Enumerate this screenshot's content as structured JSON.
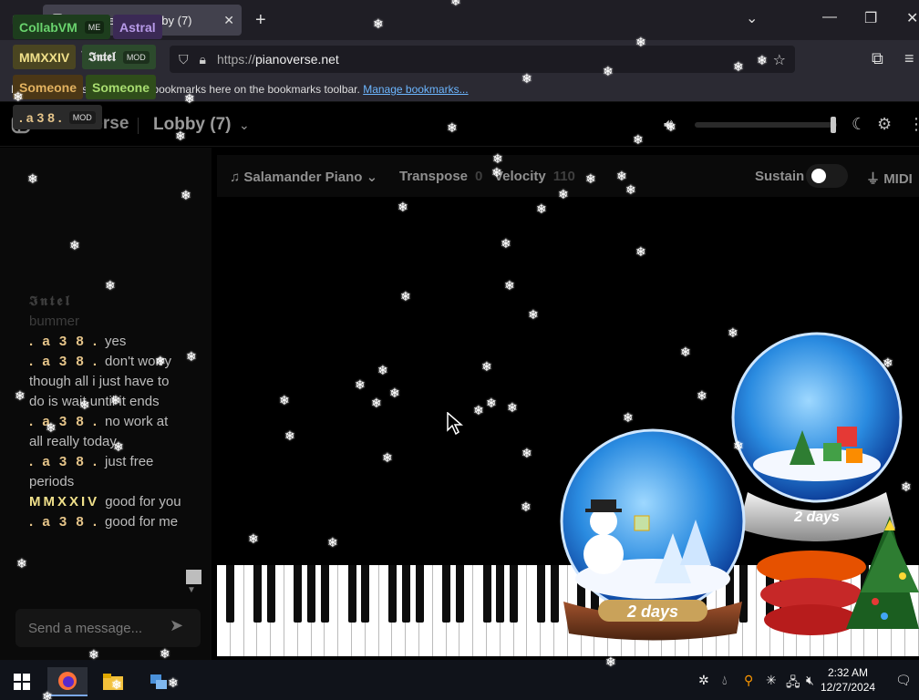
{
  "browser": {
    "tab_title": "Pianoverse - Lobby (7)",
    "url_prefix": "https://",
    "url_host": "pianoverse.net",
    "bookmarks_text": "For quick access, place your bookmarks here on the bookmarks toolbar.",
    "bookmarks_link": "Manage bookmarks..."
  },
  "header": {
    "logo": "Pianoverse",
    "room": "Lobby (7)"
  },
  "users": [
    {
      "name": "CollabVM",
      "badge": "ME",
      "bg": "#1d3d1d",
      "fg": "#69d36d"
    },
    {
      "name": "Astral",
      "badge": "",
      "bg": "#3b2a55",
      "fg": "#b79ae8"
    },
    {
      "name": "MMXXIV",
      "badge": "",
      "bg": "#4a4521",
      "fg": "#f0e08a"
    },
    {
      "name": "𝕴𝖓𝖙𝖊𝖑",
      "badge": "MOD",
      "bg": "#2c4a2c",
      "fg": "#e0e0e0"
    },
    {
      "name": "Someone",
      "badge": "",
      "bg": "#4b3716",
      "fg": "#e2b260"
    },
    {
      "name": "Someone",
      "badge": "",
      "bg": "#2f4d1a",
      "fg": "#a8dd70"
    },
    {
      "name": ". a 3 8 .",
      "badge": "MOD",
      "bg": "#2a2a2a",
      "fg": "#e6c58a"
    }
  ],
  "chat": {
    "messages": [
      {
        "who": "𝕴𝖓𝖙𝖊𝖑",
        "text": "",
        "color": "#3d3d3d",
        "faded": true
      },
      {
        "who": "",
        "text": "bummer",
        "color": "#3d3d3d",
        "faded": true
      },
      {
        "who": ". a 3 8 .",
        "text": "yes",
        "color": "#e6c58a",
        "faded": false
      },
      {
        "who": ". a 3 8 .",
        "text": "don't worry though all i just have to do is wait until it ends",
        "color": "#e6c58a",
        "faded": false
      },
      {
        "who": ". a 3 8 .",
        "text": "no work at all really today",
        "color": "#e6c58a",
        "faded": false
      },
      {
        "who": ". a 3 8 .",
        "text": "just free periods",
        "color": "#e6c58a",
        "faded": false
      },
      {
        "who": "MMXXIV",
        "text": "good for you",
        "color": "#f0e08a",
        "faded": false
      },
      {
        "who": ". a 3 8 .",
        "text": "good for me",
        "color": "#e6c58a",
        "faded": false
      }
    ],
    "input_placeholder": "Send a message..."
  },
  "toolbar": {
    "instrument": "Salamander Piano",
    "transpose_label": "Transpose",
    "transpose_value": "0",
    "velocity_label": "Velocity",
    "velocity_value": "110",
    "sustain_label": "Sustain",
    "midi_label": "MIDI"
  },
  "volume": {
    "level": 0.99
  },
  "globes": [
    {
      "label": "2 days"
    },
    {
      "label": "2 days"
    }
  ],
  "taskbar": {
    "time": "2:32 AM",
    "date": "12/27/2024"
  }
}
